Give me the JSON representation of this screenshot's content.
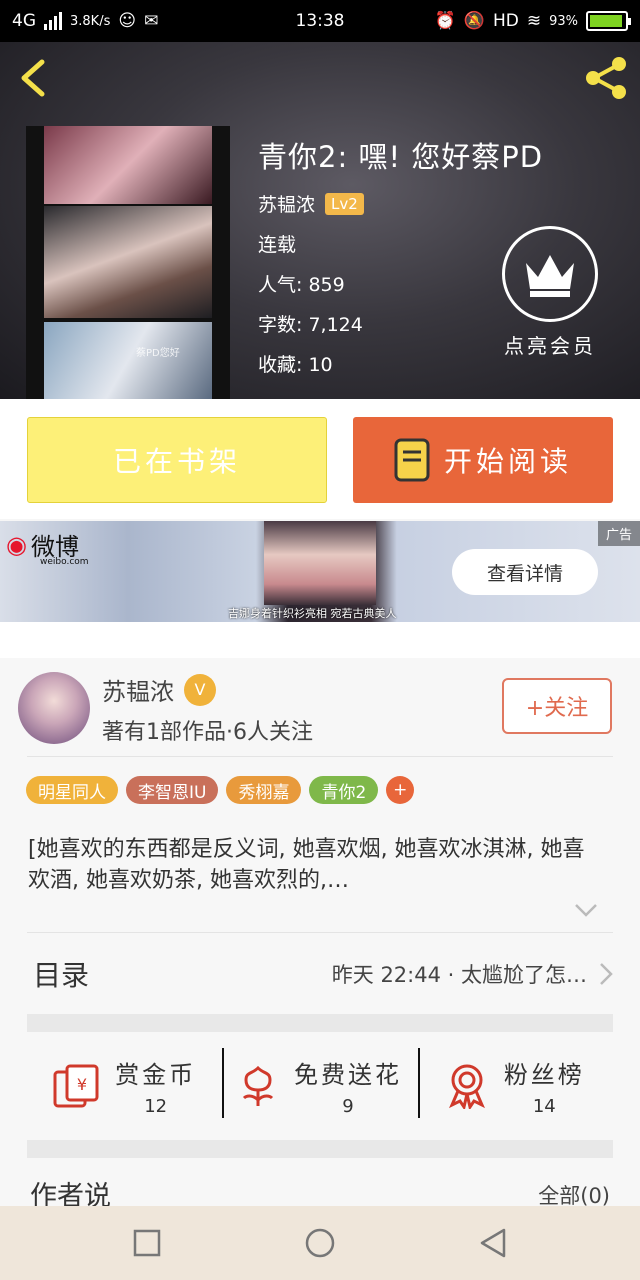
{
  "status_bar": {
    "network": "4G",
    "speed": "3.8K/s",
    "time": "13:38",
    "hd": "HD",
    "battery": "93%",
    "battery_level": 0.93
  },
  "book": {
    "title": "青你2: 嘿! 您好蔡PD",
    "author": "苏韫浓",
    "level": "Lv2",
    "status": "连载",
    "popularity": "人气: 859",
    "word_count": "字数: 7,124",
    "favorites": "收藏: 10",
    "cover_caption": "蔡PD您好"
  },
  "vip": {
    "label": "点亮会员"
  },
  "actions": {
    "shelf": "已在书架",
    "read": "开始阅读"
  },
  "ad": {
    "brand": "微博",
    "brand_domain": "weibo.com",
    "tag": "广告",
    "cta": "查看详情",
    "caption": "吉娜身着针织衫亮相 宛若古典美人"
  },
  "author": {
    "name": "苏韫浓",
    "verified_badge": "V",
    "summary": "著有1部作品·6人关注",
    "follow": "+关注"
  },
  "tags": [
    {
      "label": "明星同人",
      "color": "#f0b23a"
    },
    {
      "label": "李智恩IU",
      "color": "#c9705a"
    },
    {
      "label": "秀栩嘉",
      "color": "#e89a3c"
    },
    {
      "label": "青你2",
      "color": "#7fb84a"
    }
  ],
  "tag_add": "+",
  "description": "[她喜欢的东西都是反义词, 她喜欢烟, 她喜欢冰淇淋, 她喜欢酒, 她喜欢奶茶, 她喜欢烈的,…",
  "toc": {
    "title": "目录",
    "latest": "昨天 22:44 · 太尴尬了怎…"
  },
  "stats": [
    {
      "label": "赏金币",
      "value": "12",
      "icon": "red-envelope-icon"
    },
    {
      "label": "免费送花",
      "value": "9",
      "icon": "flower-icon"
    },
    {
      "label": "粉丝榜",
      "value": "14",
      "icon": "medal-icon"
    }
  ],
  "author_says": {
    "title": "作者说",
    "all": "全部(0)"
  },
  "colors": {
    "accent": "#e8663a",
    "shelf": "#fdf078",
    "gold": "#f0b23a"
  }
}
